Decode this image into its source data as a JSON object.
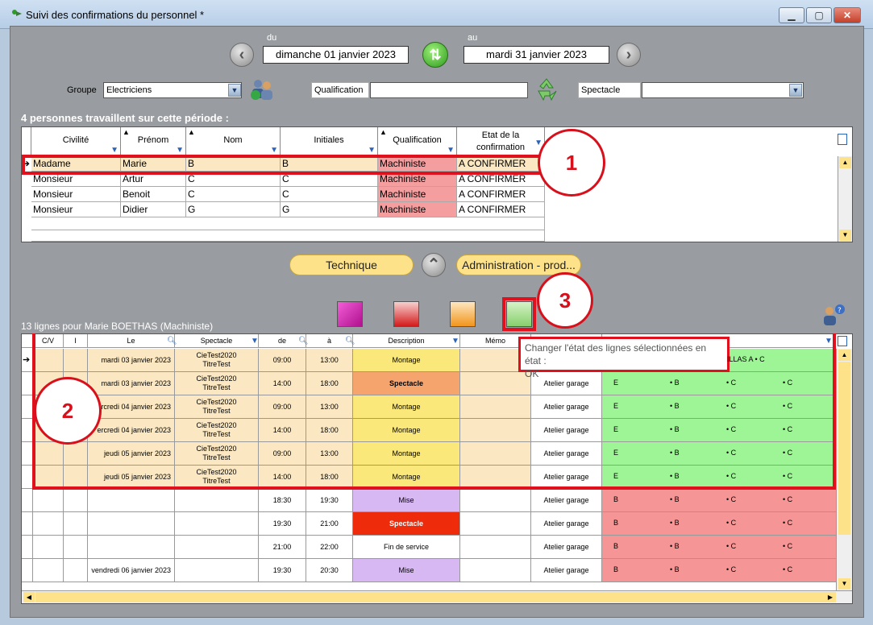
{
  "window": {
    "title": "Suivi des confirmations du personnel *"
  },
  "period": {
    "from_label": "du",
    "to_label": "au",
    "from_date": "dimanche 01 janvier 2023",
    "to_date": "mardi 31 janvier 2023"
  },
  "filters": {
    "group_label": "Groupe",
    "group_value": "Electriciens",
    "qualification_label": "Qualification",
    "qualification_value": "",
    "spectacle_label": "Spectacle",
    "spectacle_value": ""
  },
  "upper": {
    "summary": "4 personnes travaillent sur cette période :",
    "columns": [
      "Civilité",
      "Prénom",
      "Nom",
      "Initiales",
      "Qualification",
      "Etat de la confirmation"
    ],
    "rows": [
      [
        "Madame",
        "Marie",
        "B",
        "B",
        "Machiniste",
        "A CONFIRMER"
      ],
      [
        "Monsieur",
        "Artur",
        "C",
        "C",
        "Machiniste",
        "A CONFIRMER"
      ],
      [
        "Monsieur",
        "Benoit",
        "C",
        "C",
        "Machiniste",
        "A CONFIRMER"
      ],
      [
        "Monsieur",
        "Didier",
        "G",
        "G",
        "Machiniste",
        "A CONFIRMER"
      ]
    ]
  },
  "tabs": {
    "technique": "Technique",
    "administration": "Administration - prod..."
  },
  "lower": {
    "summary": "13 lignes pour Marie  BOETHAS (Machiniste)",
    "columns": [
      "C/V",
      "I",
      "Le",
      "Spectacle",
      "de",
      "à",
      "Description",
      "Mémo"
    ],
    "tooltip_line1": "Changer l'état des lignes sélectionnées en état :",
    "tooltip_line2": "OK",
    "partial_text": "ILLAS A • C",
    "rows": [
      {
        "le": "mardi 03 janvier 2023",
        "sp1": "CieTest2020",
        "sp2": "TitreTest",
        "de": "09:00",
        "a": "13:00",
        "desc": "Montage",
        "lieu": "",
        "e1": "",
        "e2": "",
        "e3": "",
        "e4": ""
      },
      {
        "le": "mardi 03 janvier 2023",
        "sp1": "CieTest2020",
        "sp2": "TitreTest",
        "de": "14:00",
        "a": "18:00",
        "desc": "Spectacle",
        "lieu": "Atelier garage",
        "e1": "E",
        "e2": "• B",
        "e3": "• C",
        "e4": "• C"
      },
      {
        "le": "rcredi 04 janvier 2023",
        "sp1": "CieTest2020",
        "sp2": "TitreTest",
        "de": "09:00",
        "a": "13:00",
        "desc": "Montage",
        "lieu": "Atelier garage",
        "e1": "E",
        "e2": "• B",
        "e3": "• C",
        "e4": "• C"
      },
      {
        "le": "ercredi 04 janvier 2023",
        "sp1": "CieTest2020",
        "sp2": "TitreTest",
        "de": "14:00",
        "a": "18:00",
        "desc": "Montage",
        "lieu": "Atelier garage",
        "e1": "E",
        "e2": "• B",
        "e3": "• C",
        "e4": "• C"
      },
      {
        "le": "jeudi 05 janvier 2023",
        "sp1": "CieTest2020",
        "sp2": "TitreTest",
        "de": "09:00",
        "a": "13:00",
        "desc": "Montage",
        "lieu": "Atelier garage",
        "e1": "E",
        "e2": "• B",
        "e3": "• C",
        "e4": "• C"
      },
      {
        "le": "jeudi 05 janvier 2023",
        "sp1": "CieTest2020",
        "sp2": "TitreTest",
        "de": "14:00",
        "a": "18:00",
        "desc": "Montage",
        "lieu": "Atelier garage",
        "e1": "E",
        "e2": "• B",
        "e3": "• C",
        "e4": "• C"
      },
      {
        "le": "",
        "sp1": "",
        "sp2": "",
        "de": "18:30",
        "a": "19:30",
        "desc": "Mise",
        "lieu": "Atelier garage",
        "e1": "B",
        "e2": "• B",
        "e3": "• C",
        "e4": "• C"
      },
      {
        "le": "",
        "sp1": "",
        "sp2": "",
        "de": "19:30",
        "a": "21:00",
        "desc": "Spectacle",
        "lieu": "Atelier garage",
        "e1": "B",
        "e2": "• B",
        "e3": "• C",
        "e4": "• C"
      },
      {
        "le": "",
        "sp1": "",
        "sp2": "",
        "de": "21:00",
        "a": "22:00",
        "desc": "Fin de service",
        "lieu": "Atelier garage",
        "e1": "B",
        "e2": "• B",
        "e3": "• C",
        "e4": "• C"
      },
      {
        "le": "vendredi 06 janvier 2023",
        "sp1": "",
        "sp2": "",
        "de": "19:30",
        "a": "20:30",
        "desc": "Mise",
        "lieu": "Atelier garage",
        "e1": "B",
        "e2": "• B",
        "e3": "• C",
        "e4": "• C"
      }
    ]
  },
  "annotations": {
    "one": "1",
    "two": "2",
    "three": "3"
  },
  "colors": {
    "accent_red": "#e0101c",
    "pink": "#f49ea0",
    "green": "#9ef595",
    "salmon": "#f59595",
    "yellow": "#fbe87a"
  }
}
